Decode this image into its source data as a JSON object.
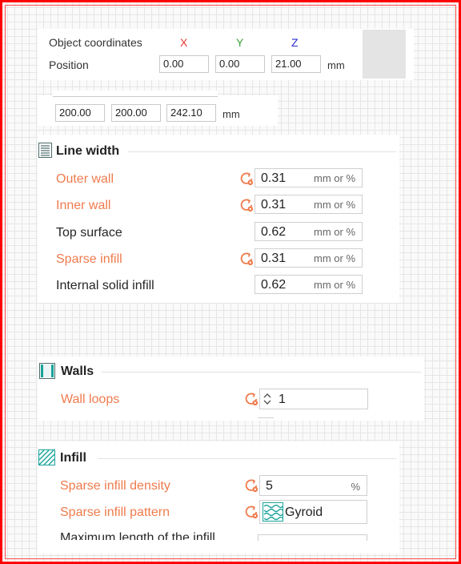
{
  "object_panel": {
    "label": "Object coordinates",
    "axes": {
      "x": "X",
      "y": "Y",
      "z": "Z"
    },
    "axis_colors": {
      "x": "#e53935",
      "y": "#3aa33a",
      "z": "#2b2bd9"
    },
    "position_label": "Position",
    "position": {
      "x": "0.00",
      "y": "0.00",
      "z": "21.00"
    },
    "unit": "mm"
  },
  "size_row": {
    "x": "200.00",
    "y": "200.00",
    "z": "242.10",
    "unit": "mm"
  },
  "line_width": {
    "title": "Line width",
    "rows": [
      {
        "label": "Outer wall",
        "value": "0.31",
        "unit": "mm or %"
      },
      {
        "label": "Inner wall",
        "value": "0.31",
        "unit": "mm or %"
      },
      {
        "label": "Top surface",
        "value": "0.62",
        "unit": "mm or %"
      },
      {
        "label": "Sparse infill",
        "value": "0.31",
        "unit": "mm or %"
      },
      {
        "label": "Internal solid infill",
        "value": "0.62",
        "unit": "mm or %"
      }
    ]
  },
  "walls": {
    "title": "Walls",
    "wall_loops_label": "Wall loops",
    "wall_loops_value": "1"
  },
  "infill": {
    "title": "Infill",
    "density_label": "Sparse infill density",
    "density_value": "5",
    "density_unit": "%",
    "pattern_label": "Sparse infill pattern",
    "pattern_value": "Gyroid",
    "max_length_label": "Maximum length of the infill"
  },
  "colors": {
    "modified": "#ef7b4d",
    "accent_teal": "#1aa39a"
  },
  "icons": {
    "reset": "reset-arrow-icon",
    "line_width": "line-width-icon",
    "walls": "walls-icon",
    "infill": "infill-icon",
    "gyroid": "gyroid-pattern-icon",
    "spinner": "spin-arrows-icon"
  }
}
